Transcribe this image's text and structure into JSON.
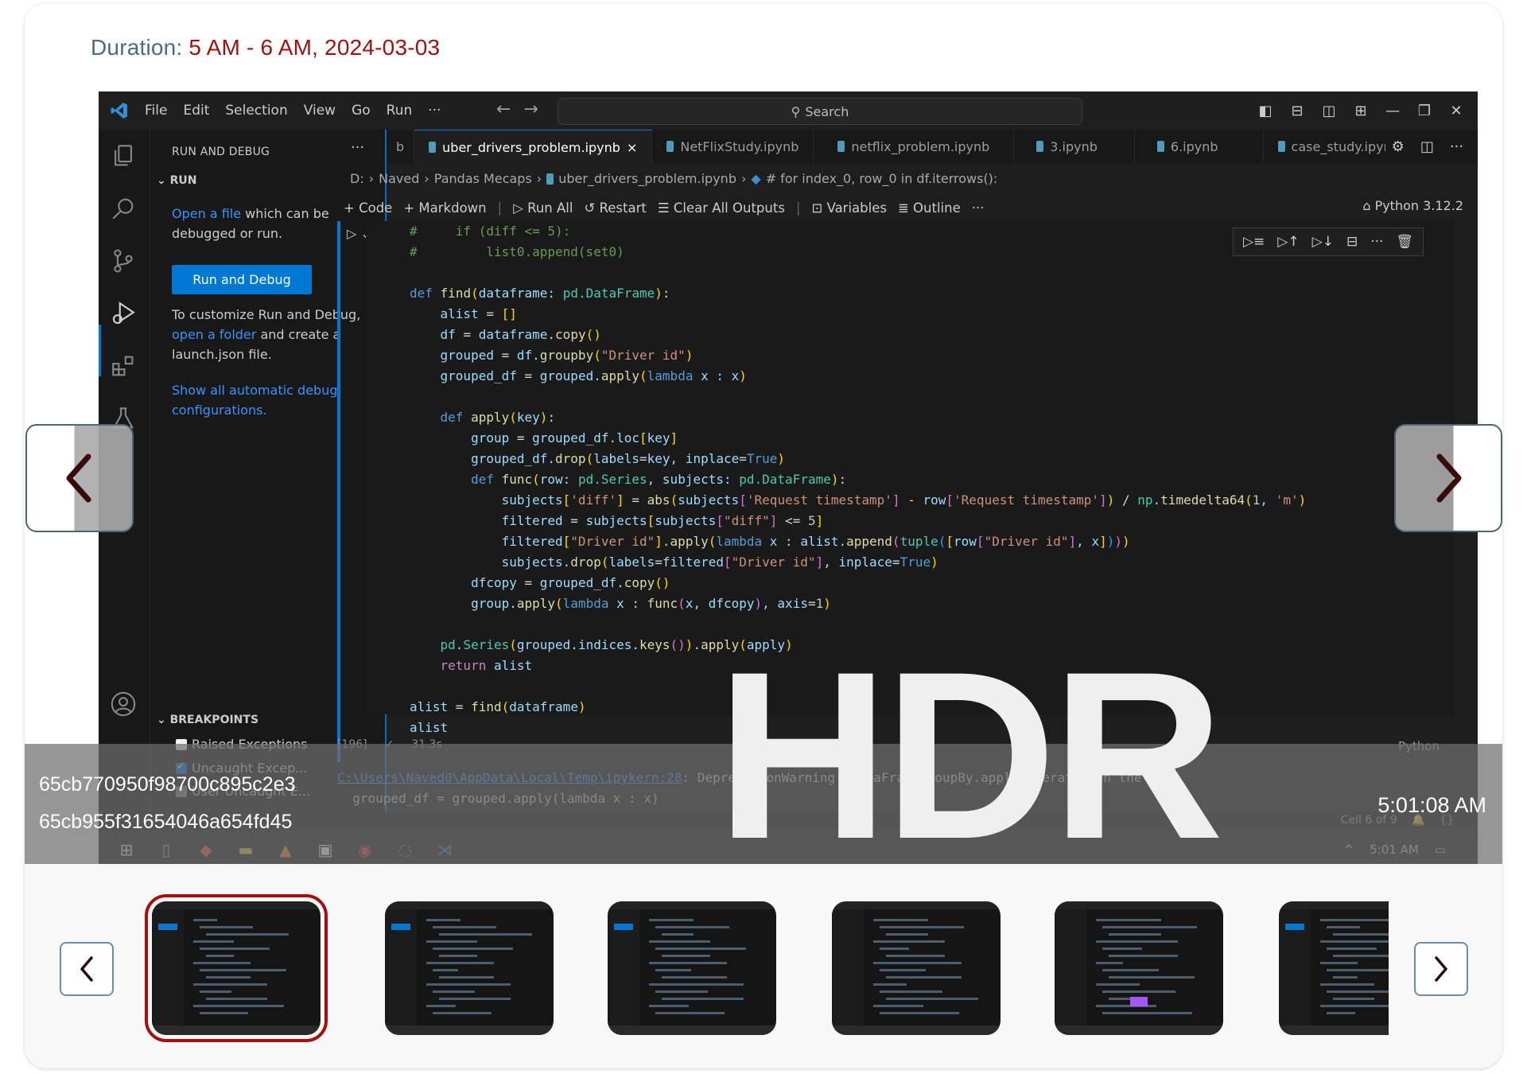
{
  "header": {
    "duration_label": "Duration:",
    "duration_value": "5 AM - 6 AM, 2024-03-03"
  },
  "vscode": {
    "menu": [
      "File",
      "Edit",
      "Selection",
      "View",
      "Go",
      "Run",
      "···"
    ],
    "search_placeholder": "Search",
    "sidebar": {
      "title": "RUN AND DEBUG",
      "more": "···",
      "run_section": "RUN",
      "open_file_link": "Open a file",
      "open_file_rest": " which can be debugged or run.",
      "run_debug_button": "Run and Debug",
      "customize_text_1": "To customize Run and Debug, ",
      "open_folder_link": "open a folder",
      "customize_text_2": " and create a launch.json file.",
      "show_all_link": "Show all automatic debug configurations.",
      "breakpoints_section": "BREAKPOINTS",
      "breakpoints": [
        {
          "label": "Raised Exceptions",
          "checked": false
        },
        {
          "label": "Uncaught Excep...",
          "checked": true
        },
        {
          "label": "User Uncaught E...",
          "checked": false
        }
      ]
    },
    "tabs": [
      {
        "label": "b",
        "active": false
      },
      {
        "label": "uber_drivers_problem.ipynb",
        "active": true,
        "close": "×"
      },
      {
        "label": "NetFlixStudy.ipynb",
        "active": false
      },
      {
        "label": "netflix_problem.ipynb",
        "active": false
      },
      {
        "label": "3.ipynb",
        "active": false
      },
      {
        "label": "6.ipynb",
        "active": false
      },
      {
        "label": "case_study.ipynl",
        "active": false
      }
    ],
    "breadcrumb": [
      "D:",
      "Naved",
      "Pandas Mecaps",
      "uber_drivers_problem.ipynb",
      "# for index_0, row_0 in df.iterrows():"
    ],
    "toolbar": {
      "code": "Code",
      "markdown": "Markdown",
      "run_all": "Run All",
      "restart": "Restart",
      "clear_outputs": "Clear All Outputs",
      "variables": "Variables",
      "outline": "Outline",
      "more": "···",
      "kernel": "Python 3.12.2"
    },
    "cell": {
      "exec_count": "[196]",
      "exec_time": "31.3s",
      "language": "Python"
    },
    "output": {
      "path_link": "C:\\Users\\Naved0\\AppData\\Local\\Temp\\ipykern",
      "line_ref": ":28",
      "warning_text": ": DeprecationWarning: DataFrameGroupBy.apply operated on the gr",
      "code_line": "  grouped_df = grouped.apply(lambda x : x)"
    },
    "status": {
      "cell_pos": "Cell 6 of 9"
    },
    "taskbar": {
      "clock": "5:01 AM"
    }
  },
  "overlay": {
    "id_primary": "65cb770950f98700c895c2e3",
    "id_secondary": "65cb955f31654046a654fd45",
    "timestamp": "5:01:08 AM",
    "badge": "HDR"
  },
  "gallery": {
    "thumbnail_count": 6,
    "selected_index": 0
  }
}
